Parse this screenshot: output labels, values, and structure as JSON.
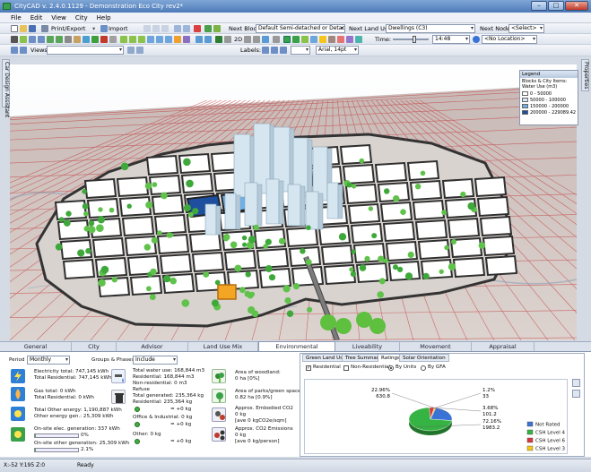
{
  "window": {
    "title": "CityCAD  v. 2.4.0.1129 - Demonstration Eco City rev2*"
  },
  "menu": [
    "File",
    "Edit",
    "View",
    "City",
    "Help"
  ],
  "toolbar": {
    "print_export": "Print/Export",
    "import": "Import",
    "next_block_label": "Next Block:",
    "next_block_value": "Default Semi-detached or Detache...",
    "next_land_use_label": "Next Land Use:",
    "next_land_use_value": "Dwellings (C3)",
    "next_node_label": "Next Node:",
    "next_node_value": "<Select>",
    "time_label": "Time:",
    "time_value": "14:48",
    "location_value": "<No Location>",
    "views_label": "Views",
    "labels_label": "Labels:",
    "font_value": "Arial, 14pt",
    "mode_2d": "2D"
  },
  "side_tabs": {
    "left": "Car Design Assistant",
    "right": "Properties"
  },
  "legend": {
    "title": "Legend",
    "subtitle": "Blocks & City Items: Water Use (m3)",
    "items": [
      {
        "label": "0 - 50000",
        "color": "#ffffff"
      },
      {
        "label": "50000 - 100000",
        "color": "#d6e9fb"
      },
      {
        "label": "150000 - 200000",
        "color": "#6fb0e6"
      },
      {
        "label": "200000 - 229089.42",
        "color": "#1d4f9e"
      }
    ]
  },
  "tabs": [
    {
      "label": "General",
      "active": false
    },
    {
      "label": "City",
      "active": false
    },
    {
      "label": "Advisor",
      "active": false
    },
    {
      "label": "Land Use Mix",
      "active": false
    },
    {
      "label": "Environmental",
      "active": true
    },
    {
      "label": "Liveability",
      "active": false
    },
    {
      "label": "Movement",
      "active": false
    },
    {
      "label": "Appraisal",
      "active": false
    }
  ],
  "env": {
    "period_label": "Period",
    "period_value": "Monthly",
    "groups_label": "Groups & Phases",
    "groups_value": "Include",
    "energy": {
      "electricity_total": "Electricity total: 747,145 kWh",
      "electricity_residential": "Total Residential: 747,145 kWh",
      "gas_total": "Gas total: 0 kWh",
      "gas_residential": "Total Residential: 0 kWh",
      "other_energy": "Total Other energy: 1,190,887 kWh",
      "other_energy_gen": "Other energy gen.: 25,309 kWh",
      "onsite_elec": "On-site elec. generation: 337 kWh",
      "onsite_elec_pct": "0%",
      "onsite_elec_fill": 0.005,
      "onsite_other": "On-site other generation: 25,309 kWh",
      "onsite_other_pct": "2.1%",
      "onsite_other_fill": 0.021
    },
    "water": {
      "total": "Total water use: 168,844 m3",
      "residential": "Residential: 168,844 m3",
      "non_residential": "Non-residential: 0 m3",
      "refuse_label": "Refuse",
      "refuse_total": "Total generated: 235,364 kg",
      "refuse_residential": "Residential: 235,364 kg",
      "refuse_res_change": "= +0 kg",
      "office": "Office & Industrial: 0 kg",
      "office_change": "= +0 kg",
      "other": "Other: 0 kg",
      "other_change": "= +0 kg"
    },
    "land": {
      "woodland_label": "Area of woodland:",
      "woodland_value": "0 ha [0%]",
      "parks_label": "Area of parks/green space:",
      "parks_value": "0.82 ha [0.9%]",
      "embodied_label": "Approx. Embodied CO2",
      "embodied_value": "0 kg",
      "embodied_rate": "[ave 0 kgCO2e/sqm]",
      "emissions_label": "Approx. CO2 Emissions",
      "emissions_value": "0 kg",
      "emissions_rate": "[ave 0 kg/person]"
    }
  },
  "ratings": {
    "tabs": [
      "Green Land Use",
      "Tree Summary",
      "Ratings",
      "Solar Orientation"
    ],
    "active_tab": "Ratings",
    "residential_label": "Residential",
    "non_residential_label": "Non-Residential",
    "by_units_label": "By Units",
    "by_gfa_label": "By GFA"
  },
  "chart_data": {
    "type": "pie",
    "slices": [
      {
        "name": "Not Rated",
        "value": 630.8,
        "label_pct": "22.96%",
        "label_val": "630.8",
        "color": "#3a73d6"
      },
      {
        "name": "CSH Level 4",
        "value": 1983.2,
        "label_pct": "72.16%",
        "label_val": "1983.2",
        "color": "#35b343"
      },
      {
        "name": "CSH Level 6",
        "value": 101.2,
        "label_pct": "3.68%",
        "label_val": "101.2",
        "color": "#d9363e"
      },
      {
        "name": "CSH Level 3",
        "value": 33,
        "label_pct": "1.2%",
        "label_val": "33",
        "color": "#f5c518"
      }
    ],
    "legend_position": "right"
  },
  "status": {
    "coords": "X:-52 Y:195 Z:0",
    "state": "Ready"
  }
}
